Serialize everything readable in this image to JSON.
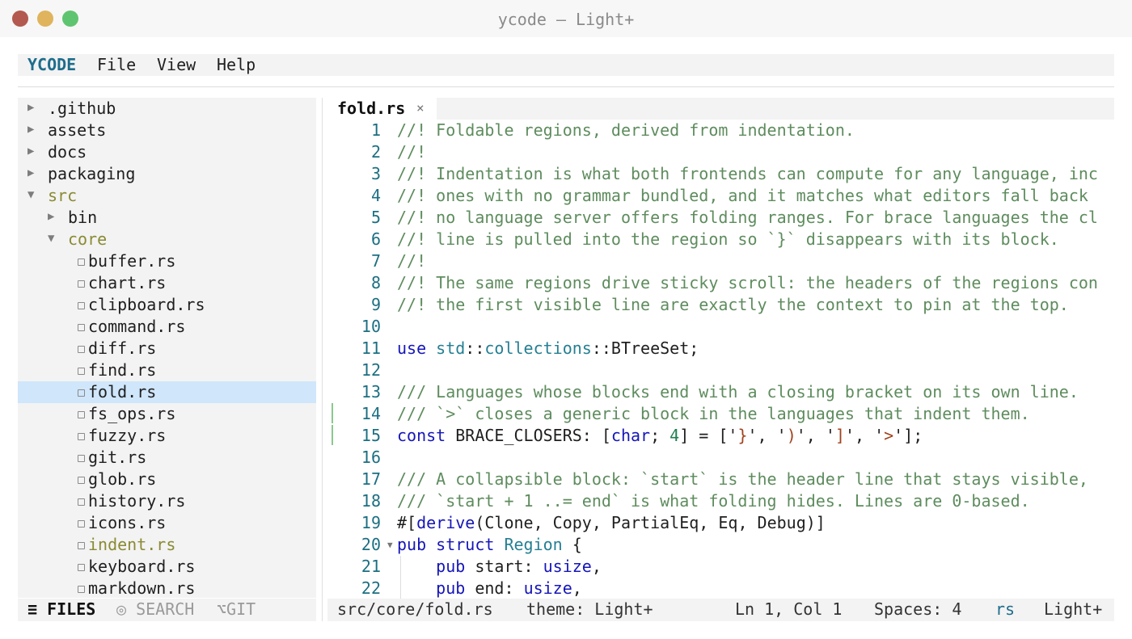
{
  "window": {
    "title": "ycode — Light+"
  },
  "menu": {
    "brand": "YCODE",
    "items": [
      "File",
      "View",
      "Help"
    ]
  },
  "tree": [
    {
      "label": ".github",
      "kind": "dir",
      "expanded": false,
      "depth": 0
    },
    {
      "label": "assets",
      "kind": "dir",
      "expanded": false,
      "depth": 0
    },
    {
      "label": "docs",
      "kind": "dir",
      "expanded": false,
      "depth": 0
    },
    {
      "label": "packaging",
      "kind": "dir",
      "expanded": false,
      "depth": 0
    },
    {
      "label": "src",
      "kind": "dir",
      "expanded": true,
      "depth": 0,
      "modified": true
    },
    {
      "label": "bin",
      "kind": "dir",
      "expanded": false,
      "depth": 1
    },
    {
      "label": "core",
      "kind": "dir",
      "expanded": true,
      "depth": 1,
      "modified": true
    },
    {
      "label": "buffer.rs",
      "kind": "file",
      "depth": 2
    },
    {
      "label": "chart.rs",
      "kind": "file",
      "depth": 2
    },
    {
      "label": "clipboard.rs",
      "kind": "file",
      "depth": 2
    },
    {
      "label": "command.rs",
      "kind": "file",
      "depth": 2
    },
    {
      "label": "diff.rs",
      "kind": "file",
      "depth": 2
    },
    {
      "label": "find.rs",
      "kind": "file",
      "depth": 2
    },
    {
      "label": "fold.rs",
      "kind": "file",
      "depth": 2,
      "selected": true
    },
    {
      "label": "fs_ops.rs",
      "kind": "file",
      "depth": 2
    },
    {
      "label": "fuzzy.rs",
      "kind": "file",
      "depth": 2
    },
    {
      "label": "git.rs",
      "kind": "file",
      "depth": 2
    },
    {
      "label": "glob.rs",
      "kind": "file",
      "depth": 2
    },
    {
      "label": "history.rs",
      "kind": "file",
      "depth": 2
    },
    {
      "label": "icons.rs",
      "kind": "file",
      "depth": 2
    },
    {
      "label": "indent.rs",
      "kind": "file",
      "depth": 2,
      "modified": true
    },
    {
      "label": "keyboard.rs",
      "kind": "file",
      "depth": 2
    },
    {
      "label": "markdown.rs",
      "kind": "file",
      "depth": 2
    }
  ],
  "sidebar_tabs": {
    "files": "≡ FILES",
    "search": "◎ SEARCH",
    "git": "⌥GIT"
  },
  "editor": {
    "tab": {
      "name": "fold.rs",
      "close": "×"
    },
    "lines": [
      {
        "n": "1",
        "t": [
          [
            "c-com",
            "//! Foldable regions, derived from indentation."
          ]
        ]
      },
      {
        "n": "2",
        "t": [
          [
            "c-com",
            "//!"
          ]
        ]
      },
      {
        "n": "3",
        "t": [
          [
            "c-com",
            "//! Indentation is what both frontends can compute for any language, inc"
          ]
        ]
      },
      {
        "n": "4",
        "t": [
          [
            "c-com",
            "//! ones with no grammar bundled, and it matches what editors fall back"
          ]
        ]
      },
      {
        "n": "5",
        "t": [
          [
            "c-com",
            "//! no language server offers folding ranges. For brace languages the cl"
          ]
        ]
      },
      {
        "n": "6",
        "t": [
          [
            "c-com",
            "//! line is pulled into the region so `}` disappears with its block."
          ]
        ]
      },
      {
        "n": "7",
        "t": [
          [
            "c-com",
            "//!"
          ]
        ]
      },
      {
        "n": "8",
        "t": [
          [
            "c-com",
            "//! The same regions drive sticky scroll: the headers of the regions con"
          ]
        ]
      },
      {
        "n": "9",
        "t": [
          [
            "c-com",
            "//! the first visible line are exactly the context to pin at the top."
          ]
        ]
      },
      {
        "n": "10",
        "t": []
      },
      {
        "n": "11",
        "t": [
          [
            "c-kw",
            "use "
          ],
          [
            "c-ty",
            "std"
          ],
          [
            "c-pl",
            "::"
          ],
          [
            "c-ty",
            "collections"
          ],
          [
            "c-pl",
            "::BTreeSet;"
          ]
        ]
      },
      {
        "n": "12",
        "t": []
      },
      {
        "n": "13",
        "t": [
          [
            "c-com",
            "/// Languages whose blocks end with a closing bracket on its own line."
          ]
        ]
      },
      {
        "n": "14",
        "t": [
          [
            "c-com",
            "/// `>` closes a generic block in the languages that indent them."
          ]
        ],
        "git": true
      },
      {
        "n": "15",
        "t": [
          [
            "c-kw",
            "const "
          ],
          [
            "c-pl",
            "BRACE_CLOSERS: ["
          ],
          [
            "c-kw",
            "char"
          ],
          [
            "c-pl",
            "; "
          ],
          [
            "c-num",
            "4"
          ],
          [
            "c-pl",
            "] = ['"
          ],
          [
            "c-str",
            "}"
          ],
          [
            "c-pl",
            "', '"
          ],
          [
            "c-str",
            ")"
          ],
          [
            "c-pl",
            "', '"
          ],
          [
            "c-str",
            "]"
          ],
          [
            "c-pl",
            "', '"
          ],
          [
            "c-str",
            ">"
          ],
          [
            "c-pl",
            "'];"
          ]
        ],
        "git": true
      },
      {
        "n": "16",
        "t": []
      },
      {
        "n": "17",
        "t": [
          [
            "c-com",
            "/// A collapsible block: `start` is the header line that stays visible,"
          ]
        ]
      },
      {
        "n": "18",
        "t": [
          [
            "c-com",
            "/// `start + 1 ..= end` is what folding hides. Lines are 0-based."
          ]
        ]
      },
      {
        "n": "19",
        "t": [
          [
            "c-pl",
            "#["
          ],
          [
            "c-kw",
            "derive"
          ],
          [
            "c-pl",
            "(Clone, Copy, PartialEq, Eq, Debug)]"
          ]
        ]
      },
      {
        "n": "20",
        "t": [
          [
            "c-kw",
            "pub struct "
          ],
          [
            "c-ty",
            "Region"
          ],
          [
            "c-pl",
            " {"
          ]
        ],
        "fold": "▼"
      },
      {
        "n": "21",
        "t": [
          [
            "c-pl",
            "    "
          ],
          [
            "c-kw",
            "pub "
          ],
          [
            "c-pl",
            "start: "
          ],
          [
            "c-kw",
            "usize"
          ],
          [
            "c-pl",
            ","
          ]
        ],
        "guide": true
      },
      {
        "n": "22",
        "t": [
          [
            "c-pl",
            "    "
          ],
          [
            "c-kw",
            "pub "
          ],
          [
            "c-pl",
            "end: "
          ],
          [
            "c-kw",
            "usize"
          ],
          [
            "c-pl",
            ","
          ]
        ],
        "guide": true
      }
    ]
  },
  "status": {
    "path": "src/core/fold.rs",
    "theme": "theme: Light+",
    "position": "Ln 1, Col 1",
    "spaces": "Spaces: 4",
    "language": "rs",
    "theme_name": "Light+"
  }
}
